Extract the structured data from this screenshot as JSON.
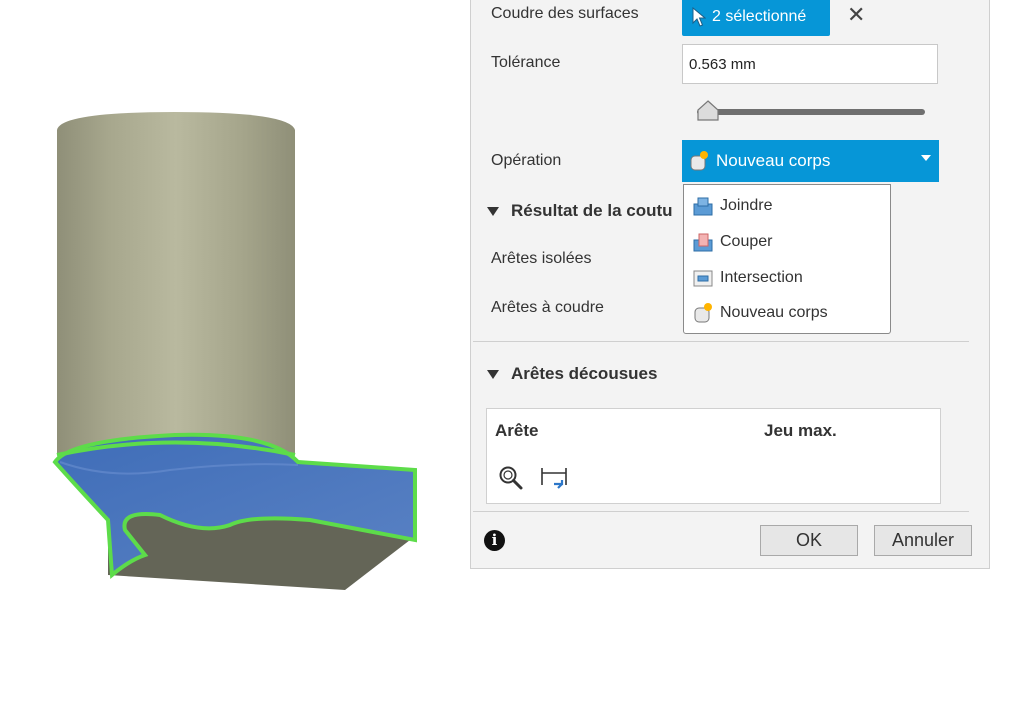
{
  "panel": {
    "stitch_label": "Coudre des surfaces",
    "selection_button_label": "2 sélectionné",
    "tolerance_label": "Tolérance",
    "tolerance_value": "0.563 mm",
    "tolerance_slider_fraction": 0.05,
    "operation_label": "Opération",
    "operation_selected": "Nouveau corps",
    "operation_options": [
      "Joindre",
      "Couper",
      "Intersection",
      "Nouveau corps"
    ],
    "result_section_title": "Résultat de la coutu",
    "isolated_edges_label": "Arêtes isolées",
    "edges_to_stitch_label": "Arêtes à coudre",
    "unstitched_section_title": "Arêtes décousues",
    "table_headers": [
      "Arête",
      "Jeu max."
    ],
    "table_tools": [
      "zoom-icon",
      "measure-gap-icon"
    ],
    "ok_label": "OK",
    "cancel_label": "Annuler"
  },
  "colors": {
    "accent": "#0696d7",
    "cylinder": "#a9a98f",
    "surface_blue": "#4a73b8",
    "selection_green": "#5ddc4a"
  }
}
